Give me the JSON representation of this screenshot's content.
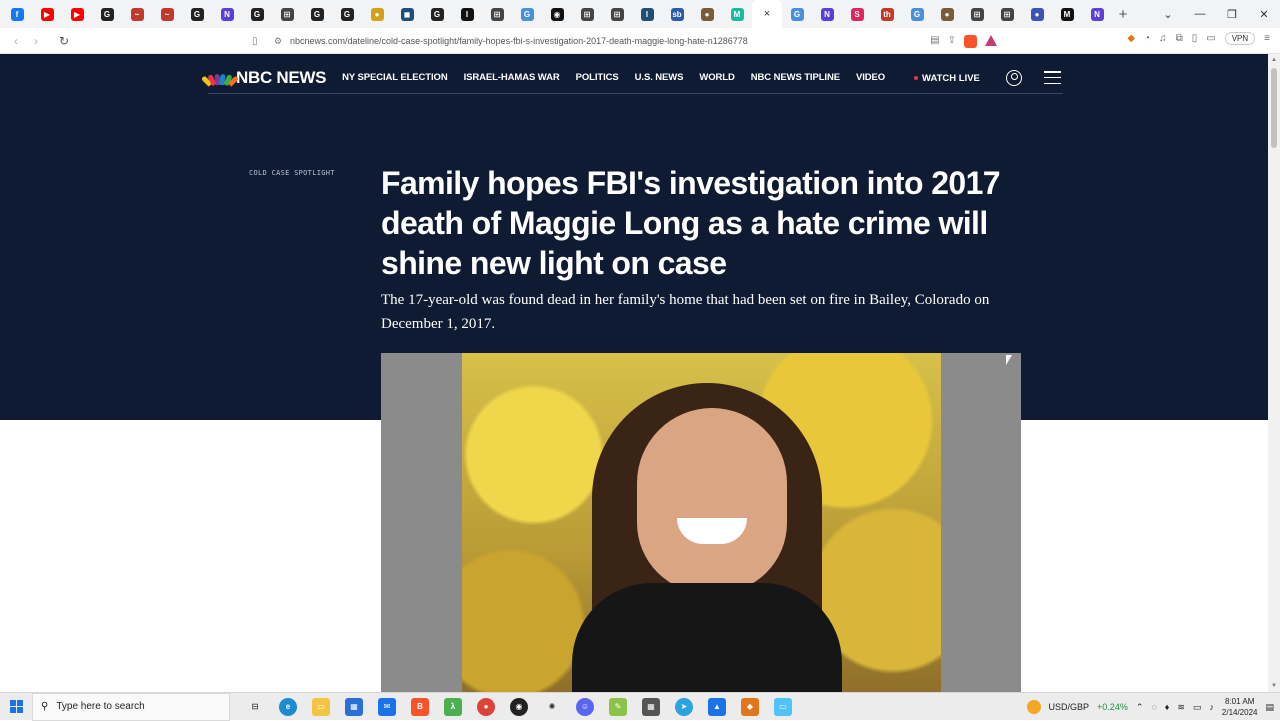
{
  "browser": {
    "tabs": [
      {
        "icon": "facebook-icon",
        "color": "#1877f2",
        "glyph": "f"
      },
      {
        "icon": "youtube-icon",
        "color": "#ff0000",
        "glyph": "▶"
      },
      {
        "icon": "youtube-icon",
        "color": "#ff0000",
        "glyph": "▶"
      },
      {
        "icon": "nyt-icon",
        "color": "#222222",
        "glyph": "G"
      },
      {
        "icon": "site-icon",
        "color": "#c0392b",
        "glyph": "~"
      },
      {
        "icon": "site-icon",
        "color": "#c0392b",
        "glyph": "~"
      },
      {
        "icon": "nyt-icon",
        "color": "#222222",
        "glyph": "G"
      },
      {
        "icon": "site-n-icon",
        "color": "#5b3fd6",
        "glyph": "N"
      },
      {
        "icon": "nyt-icon",
        "color": "#222222",
        "glyph": "G"
      },
      {
        "icon": "doc-icon",
        "color": "#444444",
        "glyph": "⊞"
      },
      {
        "icon": "nyt-icon",
        "color": "#222222",
        "glyph": "G"
      },
      {
        "icon": "nyt-icon",
        "color": "#222222",
        "glyph": "G"
      },
      {
        "icon": "site-icon",
        "color": "#d4a017",
        "glyph": "●"
      },
      {
        "icon": "site-icon",
        "color": "#1f4e79",
        "glyph": "◼"
      },
      {
        "icon": "nyt-icon",
        "color": "#222222",
        "glyph": "G"
      },
      {
        "icon": "site-icon",
        "color": "#111111",
        "glyph": "I"
      },
      {
        "icon": "doc-icon",
        "color": "#444444",
        "glyph": "⊞"
      },
      {
        "icon": "translate-icon",
        "color": "#4a90d9",
        "glyph": "G"
      },
      {
        "icon": "site-icon",
        "color": "#111111",
        "glyph": "◉"
      },
      {
        "icon": "doc-icon",
        "color": "#444444",
        "glyph": "⊞"
      },
      {
        "icon": "doc-icon",
        "color": "#444444",
        "glyph": "⊞"
      },
      {
        "icon": "site-icon",
        "color": "#1f4e79",
        "glyph": "l"
      },
      {
        "icon": "site-icon",
        "color": "#2b5cab",
        "glyph": "sb"
      },
      {
        "icon": "site-icon",
        "color": "#7a5c3a",
        "glyph": "●"
      },
      {
        "icon": "site-icon",
        "color": "#1abc9c",
        "glyph": "M"
      },
      {
        "icon": "active-tab-close-icon",
        "color": "#ffffff",
        "glyph": "×",
        "active": true
      },
      {
        "icon": "translate-icon",
        "color": "#4a90d9",
        "glyph": "G"
      },
      {
        "icon": "site-n-icon",
        "color": "#5b3fd6",
        "glyph": "N"
      },
      {
        "icon": "site-icon",
        "color": "#e0245e",
        "glyph": "S"
      },
      {
        "icon": "site-icon",
        "color": "#c0392b",
        "glyph": "th"
      },
      {
        "icon": "translate-icon",
        "color": "#4a90d9",
        "glyph": "G"
      },
      {
        "icon": "site-icon",
        "color": "#7a5c3a",
        "glyph": "●"
      },
      {
        "icon": "doc-icon",
        "color": "#444444",
        "glyph": "⊞"
      },
      {
        "icon": "doc-icon",
        "color": "#444444",
        "glyph": "⊞"
      },
      {
        "icon": "site-icon",
        "color": "#3f51b5",
        "glyph": "●"
      },
      {
        "icon": "site-icon",
        "color": "#111111",
        "glyph": "M"
      },
      {
        "icon": "site-icon",
        "color": "#5b3fd6",
        "glyph": "N"
      }
    ],
    "url": "nbcnews.com/dateline/cold-case-spotlight/family-hopes-fbi-s-investigation-2017-death-maggie-long-hate-n1286778",
    "vpn_label": "VPN"
  },
  "site": {
    "logo": "NBC NEWS",
    "nav": [
      "NY SPECIAL ELECTION",
      "ISRAEL-HAMAS WAR",
      "POLITICS",
      "U.S. NEWS",
      "WORLD",
      "NBC NEWS TIPLINE",
      "VIDEO"
    ],
    "watch_live": "WATCH LIVE",
    "peacock_colors": [
      "#f4c11a",
      "#e8334a",
      "#7a3c97",
      "#1f80c6",
      "#2fb24c",
      "#f37021"
    ]
  },
  "article": {
    "eyebrow": "COLD CASE SPOTLIGHT",
    "headline": "Family hopes FBI's investigation into 2017 death of Maggie Long as a hate crime will shine new light on case",
    "dek": "The 17-year-old was found dead in her family's home that had been set on fire in Bailey, Colorado on December 1, 2017."
  },
  "taskbar": {
    "search_placeholder": "Type here to search",
    "currency": "USD/GBP",
    "currency_change": "+0.24%",
    "time": "8:01 AM",
    "date": "2/14/2024"
  }
}
